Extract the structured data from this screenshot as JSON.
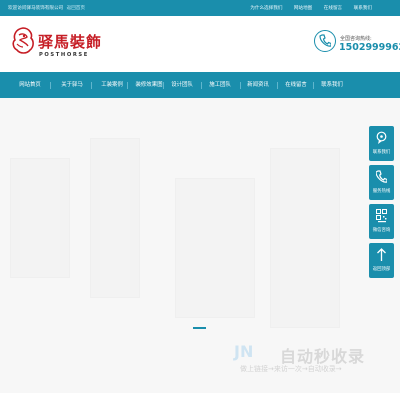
{
  "topbar": {
    "welcome": "欢迎访问驿马装饰有限公司",
    "home_link": "返回首页",
    "links": [
      "为什么选择我们",
      "网站地图",
      "在线留言",
      "联系我们"
    ]
  },
  "header": {
    "logo_cn": "驿馬裝飾",
    "logo_en": "POSTHORSE",
    "hotline_label": "全国咨询热线:",
    "hotline_number": "15029999622"
  },
  "nav": {
    "items": [
      "网站首页",
      "关于驿马",
      "工装案例",
      "装修效果图",
      "设计团队",
      "施工团队",
      "新闻资讯",
      "在线留言",
      "联系我们"
    ]
  },
  "sidebar": {
    "items": [
      {
        "label": "联系我们",
        "icon": "chat-icon"
      },
      {
        "label": "服务热线",
        "icon": "phone-icon"
      },
      {
        "label": "微信咨询",
        "icon": "qrcode-icon"
      },
      {
        "label": "返回顶部",
        "icon": "arrow-up-icon"
      }
    ]
  },
  "watermark": {
    "mark": "JN",
    "title": "自动秒收录",
    "subtitle": "做上链接→来访一次→自动收录→"
  },
  "colors": {
    "accent": "#1a8eac",
    "logo_red": "#c61d25"
  }
}
